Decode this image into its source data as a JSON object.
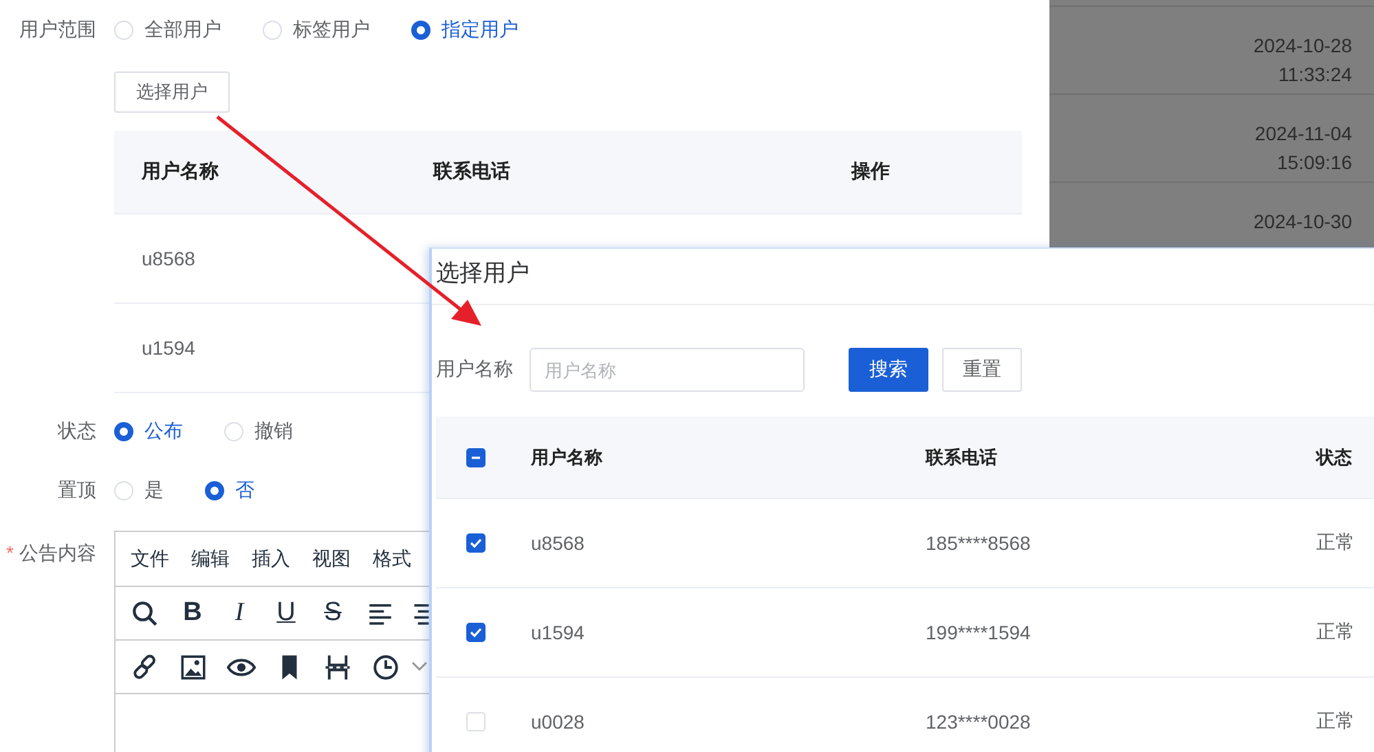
{
  "form": {
    "user_scope": {
      "label": "用户范围",
      "options": [
        {
          "label": "全部用户",
          "selected": false
        },
        {
          "label": "标签用户",
          "selected": false
        },
        {
          "label": "指定用户",
          "selected": true
        }
      ]
    },
    "select_button": "选择用户",
    "table": {
      "columns": [
        "用户名称",
        "联系电话",
        "操作"
      ],
      "rows": [
        [
          "u8568"
        ],
        [
          "u1594"
        ]
      ]
    },
    "status": {
      "label": "状态",
      "options": [
        {
          "label": "公布",
          "selected": true
        },
        {
          "label": "撤销",
          "selected": false
        }
      ]
    },
    "pinned": {
      "label": "置顶",
      "options": [
        {
          "label": "是",
          "selected": false
        },
        {
          "label": "否",
          "selected": true
        }
      ]
    },
    "content": {
      "label": "公告内容",
      "required_mark": "*",
      "menu": [
        "文件",
        "编辑",
        "插入",
        "视图",
        "格式"
      ],
      "toolbar": [
        [
          {
            "kind": "search"
          },
          {
            "kind": "bold",
            "text": "B"
          },
          {
            "kind": "italic",
            "text": "I"
          },
          {
            "kind": "underline",
            "text": "U"
          },
          {
            "kind": "strike",
            "text": "S"
          },
          {
            "kind": "align-left"
          },
          {
            "kind": "align-center"
          }
        ],
        [
          {
            "kind": "link"
          },
          {
            "kind": "image"
          },
          {
            "kind": "preview"
          },
          {
            "kind": "bookmark"
          },
          {
            "kind": "page-break"
          },
          {
            "kind": "clock"
          },
          {
            "kind": "chevron"
          }
        ]
      ]
    }
  },
  "background_list": [
    {
      "date": "2024-10-28",
      "time": "11:33:24"
    },
    {
      "date": "2024-11-04",
      "time": "15:09:16"
    },
    {
      "date": "2024-10-30"
    }
  ],
  "dialog": {
    "title": "选择用户",
    "search": {
      "label": "用户名称",
      "placeholder": "用户名称"
    },
    "buttons": [
      {
        "label": "搜索",
        "kind": "primary"
      },
      {
        "label": "重置",
        "kind": "default"
      }
    ],
    "table": {
      "select_all_indeterminate": true,
      "columns": [
        "用户名称",
        "联系电话",
        "状态"
      ],
      "rows": [
        {
          "name": "u8568",
          "phone": "185****8568",
          "status": "正常",
          "checked": true
        },
        {
          "name": "u1594",
          "phone": "199****1594",
          "status": "正常",
          "checked": true
        },
        {
          "name": "u0028",
          "phone": "123****0028",
          "status": "正常",
          "checked": false
        }
      ]
    }
  }
}
